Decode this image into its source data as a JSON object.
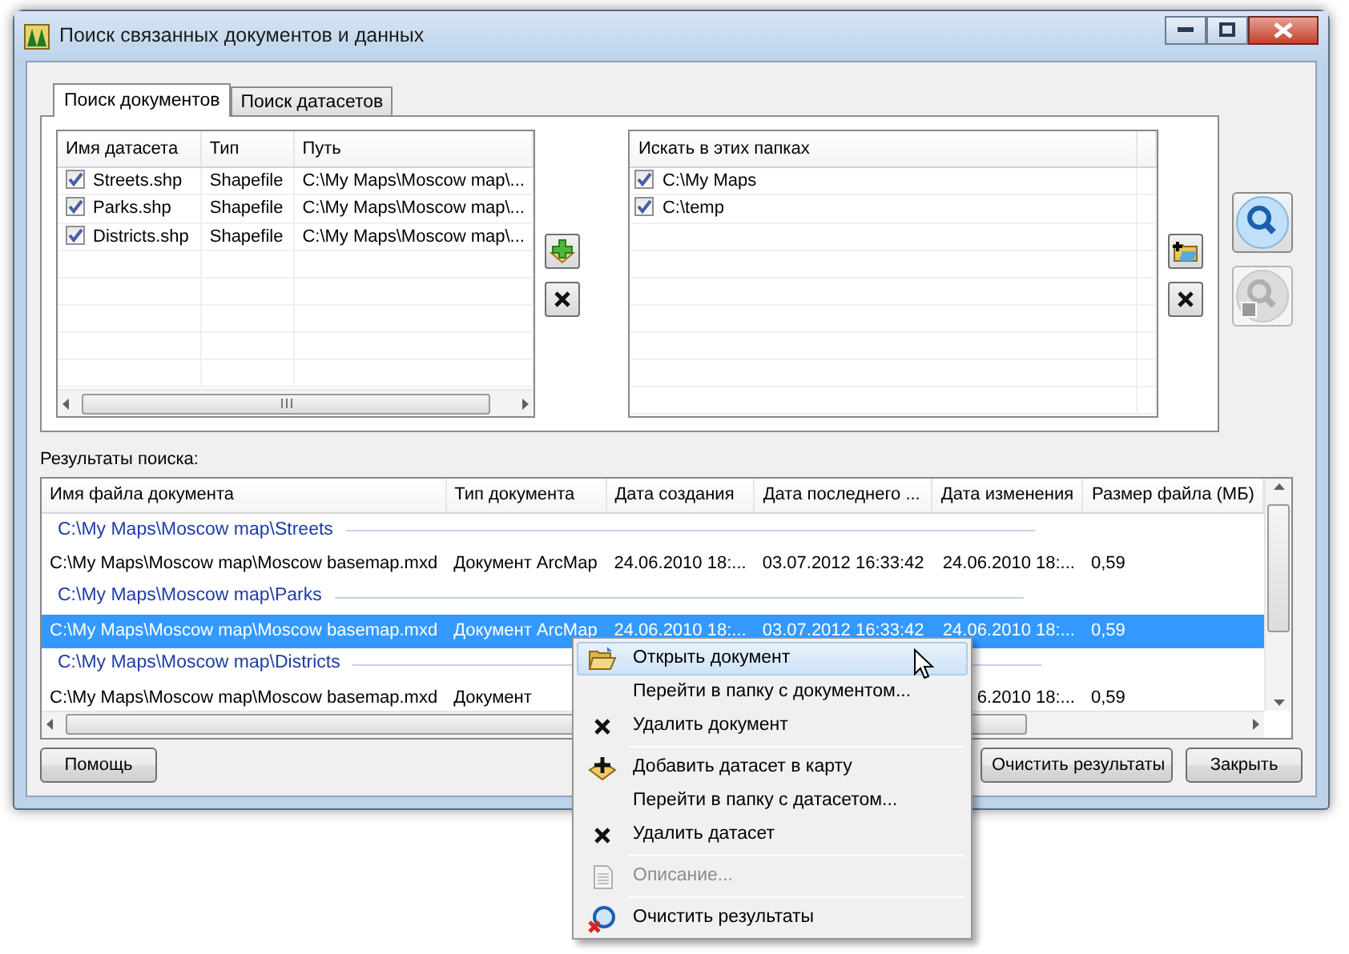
{
  "window": {
    "title": "Поиск связанных документов и данных"
  },
  "tabs": [
    {
      "label": "Поиск документов",
      "selected": true
    },
    {
      "label": "Поиск датасетов",
      "selected": false
    }
  ],
  "datasets": {
    "columns": [
      "Имя датасета",
      "Тип",
      "Путь"
    ],
    "rows": [
      {
        "checked": true,
        "name": "Streets.shp",
        "type": "Shapefile",
        "path": "C:\\My Maps\\Moscow map\\..."
      },
      {
        "checked": true,
        "name": "Parks.shp",
        "type": "Shapefile",
        "path": "C:\\My Maps\\Moscow map\\..."
      },
      {
        "checked": true,
        "name": "Districts.shp",
        "type": "Shapefile",
        "path": "C:\\My Maps\\Moscow map\\..."
      }
    ]
  },
  "folders": {
    "columns": [
      "Искать в этих папках"
    ],
    "rows": [
      {
        "checked": true,
        "path": "C:\\My Maps"
      },
      {
        "checked": true,
        "path": "C:\\temp"
      }
    ]
  },
  "search_buttons": [
    {
      "disabled": false
    },
    {
      "disabled": true
    }
  ],
  "results": {
    "label": "Результаты поиска:",
    "columns": [
      "Имя файла документа",
      "Тип документа",
      "Дата создания",
      "Дата последнего ...",
      "Дата изменения",
      "Размер файла (МБ)"
    ],
    "groups": [
      {
        "folder": "C:\\My Maps\\Moscow map\\Streets",
        "rows": [
          {
            "selected": false,
            "cells": [
              "C:\\My Maps\\Moscow map\\Moscow basemap.mxd",
              "Документ ArcMap",
              "24.06.2010 18:...",
              "03.07.2012 16:33:42",
              "24.06.2010 18:...",
              "0,59"
            ]
          }
        ]
      },
      {
        "folder": "C:\\My Maps\\Moscow map\\Parks",
        "rows": [
          {
            "selected": true,
            "cells": [
              "C:\\My Maps\\Moscow map\\Moscow basemap.mxd",
              "Документ ArcMap",
              "24.06.2010 18:...",
              "03.07.2012 16:33:42",
              "24.06.2010 18:...",
              "0,59"
            ]
          }
        ]
      },
      {
        "folder": "C:\\My Maps\\Moscow map\\Districts",
        "rows": [
          {
            "selected": false,
            "cells": [
              "C:\\My Maps\\Moscow map\\Moscow basemap.mxd",
              "Документ",
              "",
              "",
              "6.2010 18:...",
              "0,59"
            ]
          }
        ]
      }
    ]
  },
  "buttons": {
    "help": "Помощь",
    "clear": "Очистить результаты",
    "close": "Закрыть"
  },
  "context_menu": [
    {
      "kind": "item",
      "label": "Открыть документ",
      "selected": true,
      "disabled": false
    },
    {
      "kind": "item",
      "label": "Перейти в папку с документом...",
      "selected": false,
      "disabled": false
    },
    {
      "kind": "item",
      "label": "Удалить документ",
      "selected": false,
      "disabled": false
    },
    {
      "kind": "separator"
    },
    {
      "kind": "item",
      "label": "Добавить датасет в карту",
      "selected": false,
      "disabled": false
    },
    {
      "kind": "item",
      "label": "Перейти в папку с датасетом...",
      "selected": false,
      "disabled": false
    },
    {
      "kind": "item",
      "label": "Удалить датасет",
      "selected": false,
      "disabled": false
    },
    {
      "kind": "separator"
    },
    {
      "kind": "item",
      "label": "Описание...",
      "selected": false,
      "disabled": true
    },
    {
      "kind": "separator"
    },
    {
      "kind": "item",
      "label": "Очистить результаты",
      "selected": false,
      "disabled": false
    }
  ]
}
